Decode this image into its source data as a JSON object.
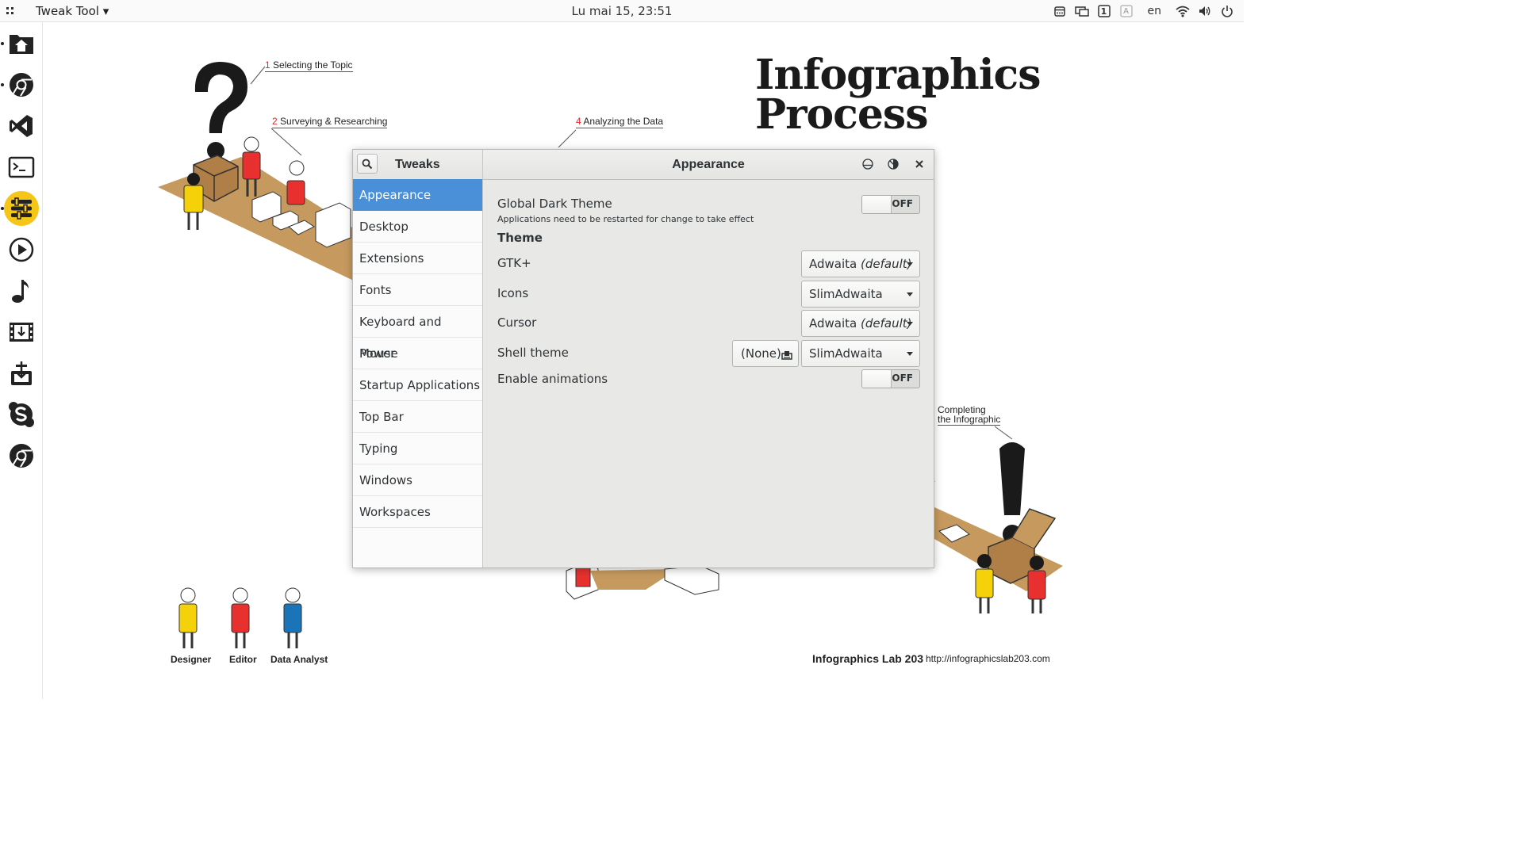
{
  "topbar": {
    "app_menu": "Tweak Tool ▾",
    "clock": "Lu mai 15, 23:51",
    "tray_lang": "en",
    "tray_workspace": "1",
    "tray_keyboard": "A",
    "tray_icons": [
      "calendar-icon",
      "screen-icon",
      "workspace-indicator-icon",
      "keyboard-layout-icon",
      "wifi-icon",
      "volume-icon",
      "power-icon"
    ]
  },
  "dock": {
    "icons": [
      "home-folder-icon",
      "chrome-icon",
      "visual-studio-code-icon",
      "terminal-icon",
      "tweak-tool-icon",
      "media-player-icon",
      "music-icon",
      "video-downloader-icon",
      "archive-installer-icon",
      "skype-icon",
      "chromium-icon"
    ]
  },
  "wallpaper": {
    "title_line1": "Infographics",
    "title_line2": "Process",
    "step1_num": "1",
    "step1": "Selecting the Topic",
    "step2_num": "2",
    "step2": "Surveying & Researching",
    "step4_num": "4",
    "step4": "Analyzing the Data",
    "step_last_line1": "Completing",
    "step_last_line2": "the Infographic",
    "legend": [
      "Designer",
      "Editor",
      "Data Analyst"
    ],
    "footer_lab": "Infographics Lab 203",
    "footer_url": "http://infographicslab203.com",
    "colors": {
      "yellow": "#f5d10a",
      "red": "#e8312f",
      "blue": "#1b73b8",
      "table": "#c69a5e"
    }
  },
  "window": {
    "left_title": "Tweaks",
    "right_title": "Appearance",
    "sidebar": [
      "Appearance",
      "Desktop",
      "Extensions",
      "Fonts",
      "Keyboard and Mouse",
      "Power",
      "Startup Applications",
      "Top Bar",
      "Typing",
      "Windows",
      "Workspaces"
    ],
    "selected_index": 0,
    "accent": "#4a90d9",
    "global_dark": {
      "label": "Global Dark Theme",
      "note": "Applications need to be restarted for change to take effect",
      "state": "OFF"
    },
    "theme_section": "Theme",
    "gtk": {
      "label": "GTK+",
      "value": "Adwaita",
      "value_suffix": "(default)"
    },
    "icons": {
      "label": "Icons",
      "value": "SlimAdwaita"
    },
    "cursor": {
      "label": "Cursor",
      "value": "Adwaita",
      "value_suffix": "(default)"
    },
    "shell": {
      "label": "Shell theme",
      "file_button": "(None)",
      "value": "SlimAdwaita"
    },
    "animations": {
      "label": "Enable animations",
      "state": "OFF"
    }
  }
}
